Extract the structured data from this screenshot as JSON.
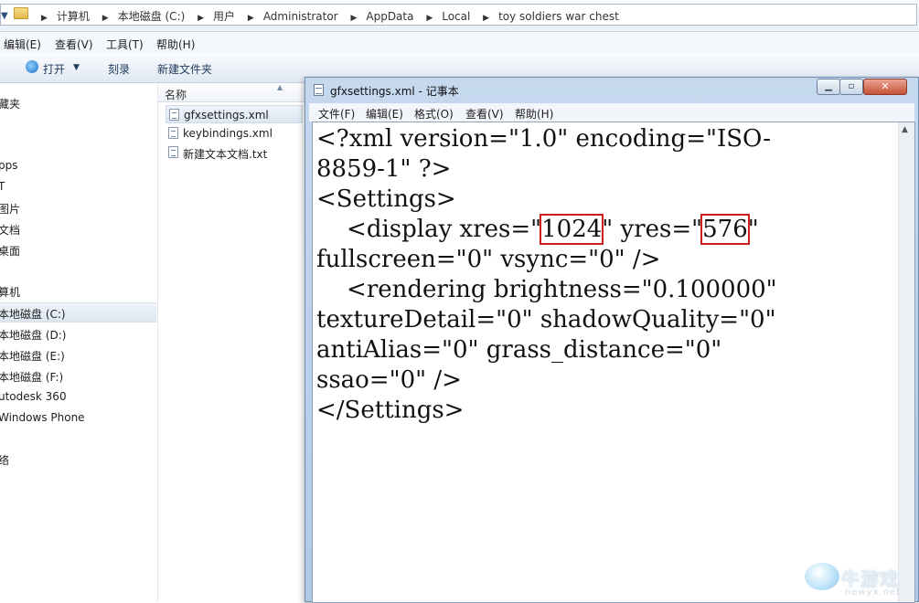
{
  "explorer": {
    "breadcrumb": [
      "计算机",
      "本地磁盘 (C:)",
      "用户",
      "Administrator",
      "AppData",
      "Local",
      "toy soldiers war chest"
    ],
    "menu": [
      "编辑(E)",
      "查看(V)",
      "工具(T)",
      "帮助(H)"
    ],
    "toolbar": {
      "open": "打开",
      "burn": "刻录",
      "new_folder": "新建文件夹"
    },
    "nav": [
      "藏夹",
      "pps",
      "T",
      "图片",
      "文档",
      "桌面",
      "算机",
      "本地磁盘 (C:)",
      "本地磁盘 (D:)",
      "本地磁盘 (E:)",
      "本地磁盘 (F:)",
      "utodesk 360",
      "Windows Phone",
      "络"
    ],
    "column_name": "名称",
    "files": [
      "gfxsettings.xml",
      "keybindings.xml",
      "新建文本文档.txt"
    ]
  },
  "notepad": {
    "title": "gfxsettings.xml - 记事本",
    "controls": {
      "minimize": "▁",
      "maximize": "▫",
      "close": "✕"
    },
    "menu": [
      "文件(F)",
      "编辑(E)",
      "格式(O)",
      "查看(V)",
      "帮助(H)"
    ],
    "text": {
      "line1": "<?xml version=\"1.0\" encoding=\"ISO-",
      "line2": "8859-1\" ?>",
      "line3": "<Settings>",
      "line4_a": "    <display xres=\"",
      "xres": "1024",
      "line4_b": "\" yres=\"",
      "yres": "576",
      "line4_c": "\"",
      "line5": "fullscreen=\"0\" vsync=\"0\" />",
      "line6": "    <rendering brightness=\"0.100000\"",
      "line7": "textureDetail=\"0\" shadowQuality=\"0\"",
      "line8": "antiAlias=\"0\" grass_distance=\"0\"",
      "line9": "ssao=\"0\" />",
      "line10": "</Settings>"
    },
    "highlight_color": "#d01c1c"
  },
  "watermark": {
    "name": "牛游戏",
    "url": "newyx.net"
  }
}
